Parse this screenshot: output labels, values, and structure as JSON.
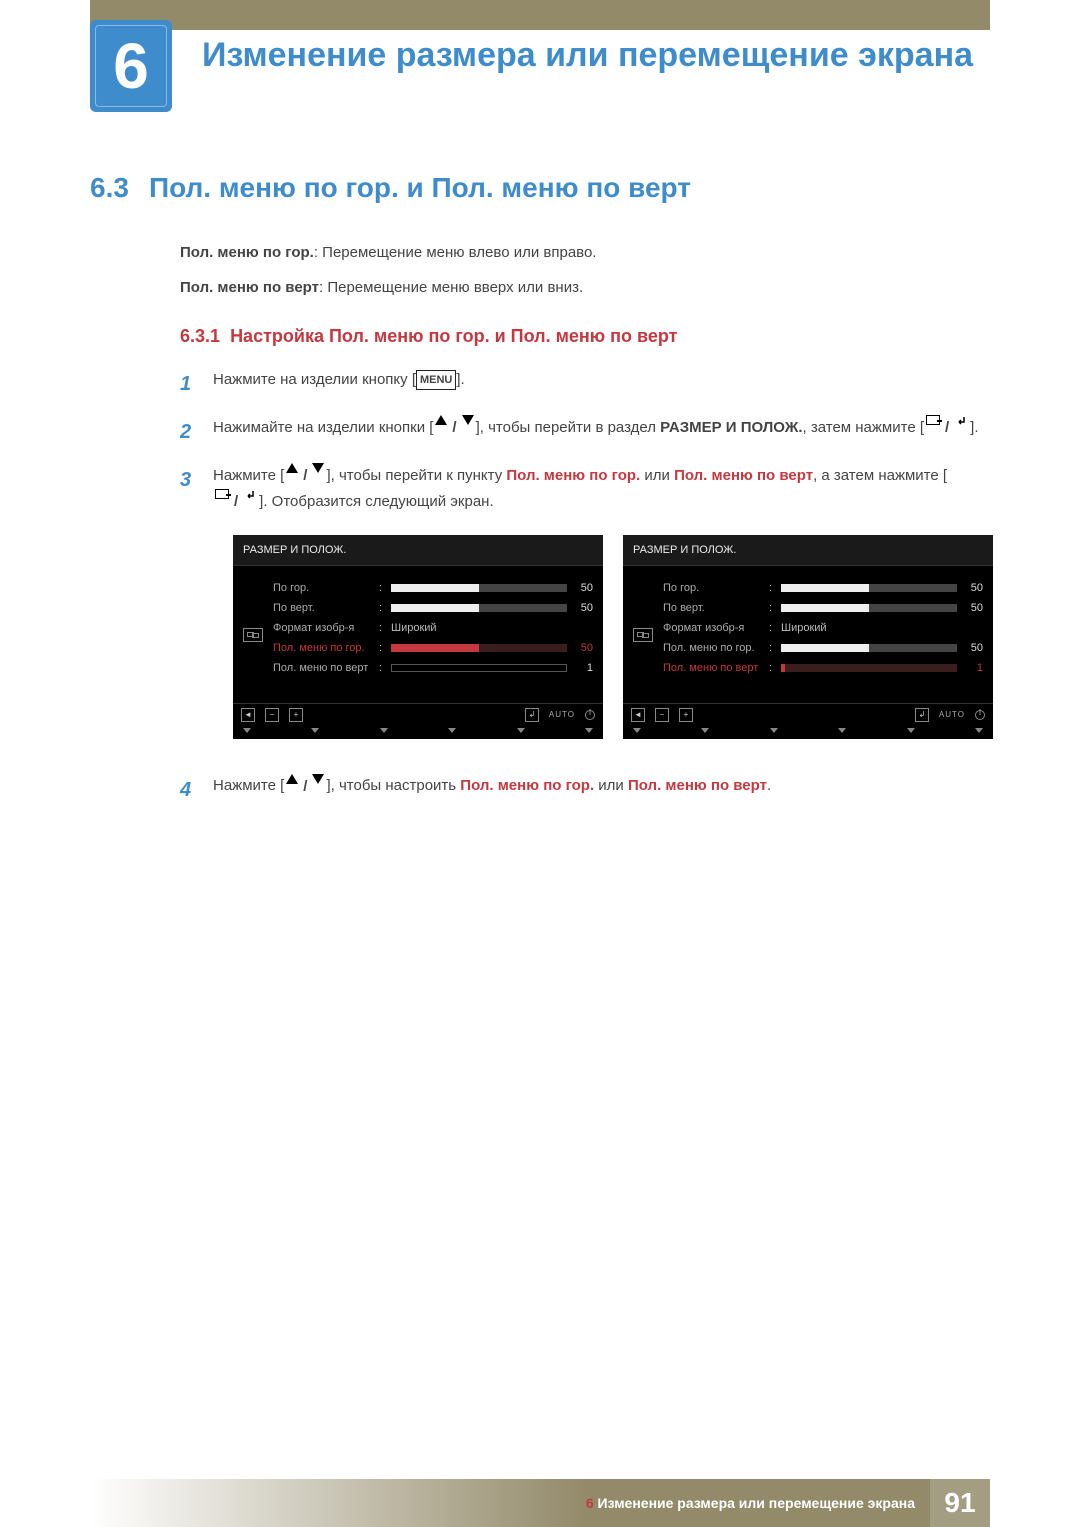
{
  "chapter": {
    "number": "6",
    "title": "Изменение размера или перемещение экрана"
  },
  "section": {
    "number": "6.3",
    "title": "Пол. меню по гор. и Пол. меню по верт"
  },
  "defs": {
    "hgor_label": "Пол. меню по гор.",
    "hgor_text": ": Перемещение меню влево или вправо.",
    "vpos_label": "Пол. меню по верт",
    "vpos_text": ": Перемещение меню вверх или вниз."
  },
  "subsection": {
    "number": "6.3.1",
    "title": "Настройка Пол. меню по гор. и Пол. меню по верт"
  },
  "steps": {
    "s1_a": "Нажмите на изделии кнопку [",
    "s1_menu": "MENU",
    "s1_b": "].",
    "s2_a": "Нажимайте на изделии кнопки [",
    "s2_b": "], чтобы перейти в раздел ",
    "s2_target": "РАЗМЕР И ПОЛОЖ.",
    "s2_c": ", затем нажмите [",
    "s2_d": "].",
    "s3_a": "Нажмите [",
    "s3_b": "], чтобы перейти к пункту ",
    "s3_t1": "Пол. меню по гор.",
    "s3_or": " или ",
    "s3_t2": "Пол. меню по верт",
    "s3_c": ", а затем нажмите [",
    "s3_d": "]. Отобразится следующий экран.",
    "s4_a": "Нажмите [",
    "s4_b": "], чтобы настроить ",
    "s4_t1": "Пол. меню по гор.",
    "s4_or": " или ",
    "s4_t2": "Пол. меню по верт",
    "s4_c": "."
  },
  "osd": {
    "title": "РАЗМЕР И ПОЛОЖ.",
    "rows": {
      "r1": {
        "label": "По гор.",
        "val": "50"
      },
      "r2": {
        "label": "По верт.",
        "val": "50"
      },
      "r3": {
        "label": "Формат изобр-я",
        "val": "Широкий"
      },
      "r4": {
        "label": "Пол. меню по гор.",
        "val": "50"
      },
      "r5": {
        "label": "Пол. меню по верт",
        "val": "1"
      }
    },
    "auto": "AUTO"
  },
  "footer": {
    "prefix": "6",
    "text": "Изменение размера или перемещение экрана",
    "page": "91"
  }
}
